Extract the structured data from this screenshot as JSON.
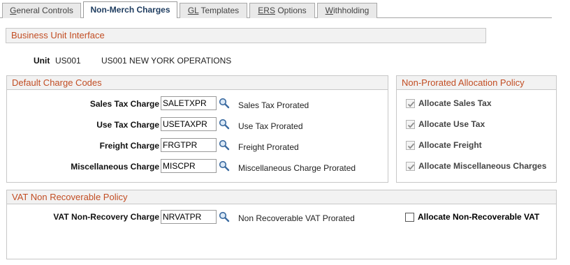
{
  "tabs": [
    {
      "label": "General Controls",
      "underline": "G",
      "rest": "eneral Controls"
    },
    {
      "label": "Non-Merch Charges",
      "underline": "",
      "rest": "Non-Merch Charges"
    },
    {
      "label": "GL Templates",
      "underline": "GL",
      "rest": " Templates"
    },
    {
      "label": "ERS Options",
      "underline": "ERS",
      "rest": " Options"
    },
    {
      "label": "Withholding",
      "underline": "W",
      "rest": "ithholding"
    }
  ],
  "business_unit": {
    "header": "Business Unit Interface",
    "unit_label": "Unit",
    "unit_value": "US001",
    "unit_desc": "US001 NEW YORK OPERATIONS"
  },
  "default_charge_codes": {
    "header": "Default Charge Codes",
    "rows": [
      {
        "label": "Sales Tax Charge",
        "value": "SALETXPR",
        "desc": "Sales Tax Prorated"
      },
      {
        "label": "Use Tax Charge",
        "value": "USETAXPR",
        "desc": "Use Tax Prorated"
      },
      {
        "label": "Freight Charge",
        "value": "FRGTPR",
        "desc": "Freight Prorated"
      },
      {
        "label": "Miscellaneous Charge",
        "value": "MISCPR",
        "desc": "Miscellaneous Charge Prorated"
      }
    ]
  },
  "non_prorated_policy": {
    "header": "Non-Prorated Allocation Policy",
    "items": [
      {
        "label": "Allocate Sales Tax",
        "checked": true
      },
      {
        "label": "Allocate Use Tax",
        "checked": true
      },
      {
        "label": "Allocate Freight",
        "checked": true
      },
      {
        "label": "Allocate Miscellaneous Charges",
        "checked": true
      }
    ]
  },
  "vat_policy": {
    "header": "VAT Non Recoverable Policy",
    "charge_label": "VAT Non-Recovery Charge",
    "charge_value": "NRVATPR",
    "charge_desc": "Non Recoverable VAT Prorated",
    "allocate_label": "Allocate Non-Recoverable VAT",
    "allocate_checked": false
  },
  "colors": {
    "header_text": "#c24d23",
    "active_tab_text": "#1f3d60"
  },
  "icons": {
    "lookup": "magnifier-icon",
    "check": "checkmark-icon"
  }
}
